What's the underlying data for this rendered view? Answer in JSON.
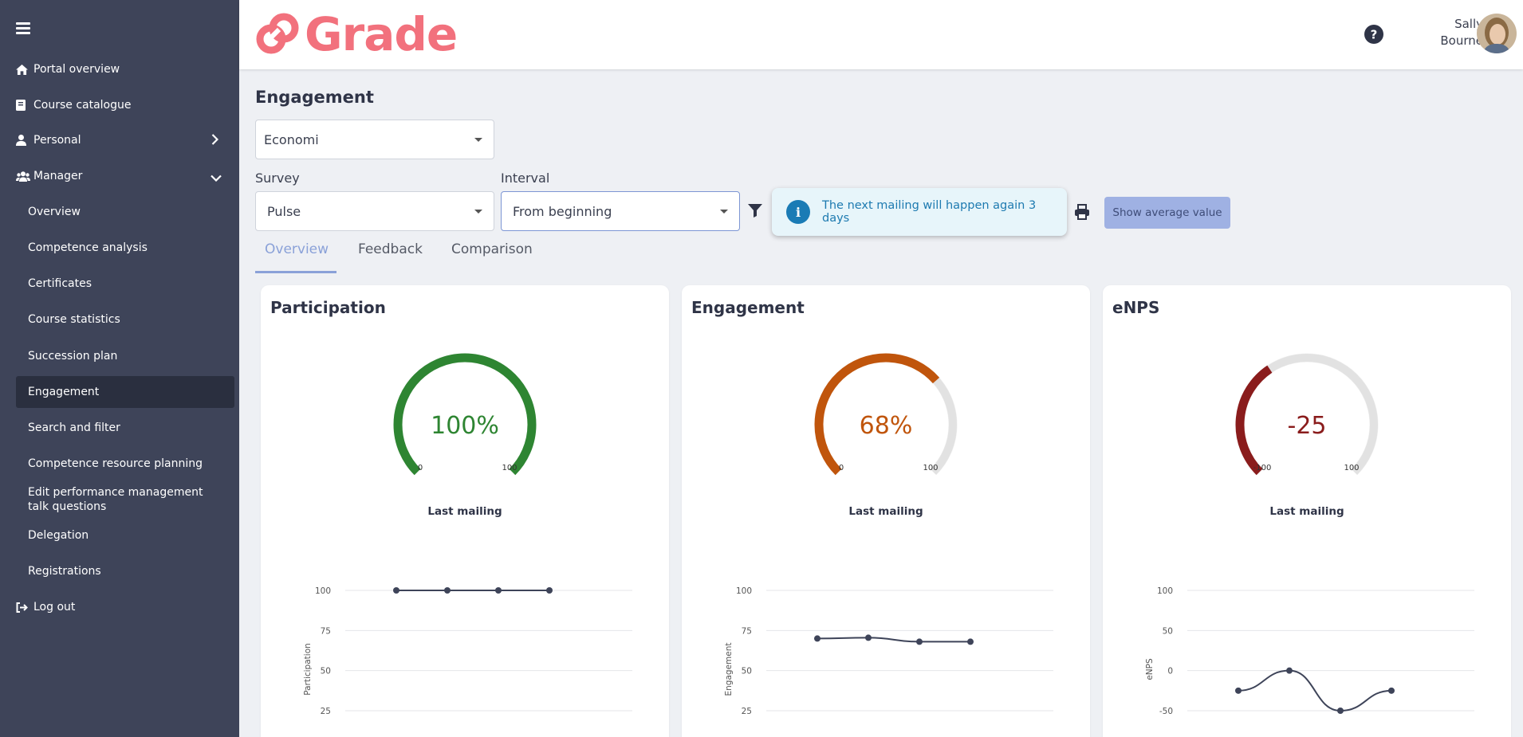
{
  "app": {
    "brand": "Grade",
    "brand_color": "#f2717d"
  },
  "user": {
    "first_name": "Sally",
    "last_name": "Bourne"
  },
  "sidebar": {
    "items": [
      {
        "label": "Portal overview",
        "icon": "home-icon"
      },
      {
        "label": "Course catalogue",
        "icon": "book-icon"
      },
      {
        "label": "Personal",
        "icon": "user-icon",
        "chevron": "chevron-right-icon"
      },
      {
        "label": "Manager",
        "icon": "users-icon",
        "chevron": "chevron-down-icon"
      }
    ],
    "manager_items": [
      {
        "label": "Overview"
      },
      {
        "label": "Competence analysis"
      },
      {
        "label": "Certificates"
      },
      {
        "label": "Course statistics"
      },
      {
        "label": "Succession plan"
      },
      {
        "label": "Engagement",
        "active": true
      },
      {
        "label": "Search and filter"
      },
      {
        "label": "Competence resource planning"
      },
      {
        "label": "Edit performance management talk questions"
      },
      {
        "label": "Delegation"
      },
      {
        "label": "Registrations"
      }
    ],
    "logout": {
      "label": "Log out",
      "icon": "logout-icon"
    }
  },
  "main": {
    "title": "Engagement",
    "department_select": {
      "value": "Economi"
    },
    "survey": {
      "label": "Survey",
      "value": "Pulse"
    },
    "interval": {
      "label": "Interval",
      "value": "From beginning"
    },
    "info_message": "The next mailing will happen again 3 days",
    "average_button": "Show average value",
    "tabs": [
      {
        "label": "Overview",
        "active": true
      },
      {
        "label": "Feedback"
      },
      {
        "label": "Comparison"
      }
    ]
  },
  "cards": [
    {
      "title": "Participation",
      "gauge_label": "100%",
      "gauge_min": "0",
      "gauge_max": "100",
      "gauge_fraction": 1.0,
      "gauge_color": "#2e8532",
      "caption": "Last mailing"
    },
    {
      "title": "Engagement",
      "gauge_label": "68%",
      "gauge_min": "0",
      "gauge_max": "100",
      "gauge_fraction": 0.68,
      "gauge_color": "#c0550c",
      "caption": "Last mailing"
    },
    {
      "title": "eNPS",
      "gauge_label": "-25",
      "gauge_min": "-100",
      "gauge_max": "100",
      "gauge_fraction": 0.375,
      "gauge_color": "#8a1c1c",
      "caption": "Last mailing"
    }
  ],
  "chart_data": [
    {
      "type": "line",
      "ylabel": "Participation",
      "yticks": [
        100,
        75,
        50,
        25
      ],
      "ylim": [
        25,
        100
      ],
      "values": [
        100,
        100,
        100,
        100
      ],
      "grid": true
    },
    {
      "type": "line",
      "ylabel": "Engagement",
      "yticks": [
        100,
        75,
        50,
        25
      ],
      "ylim": [
        25,
        100
      ],
      "values": [
        70,
        70.5,
        68,
        68
      ],
      "grid": true
    },
    {
      "type": "line",
      "ylabel": "eNPS",
      "yticks": [
        100,
        50,
        0,
        -50
      ],
      "ylim": [
        -50,
        100
      ],
      "values": [
        -25,
        0,
        -50,
        -25
      ],
      "grid": true
    }
  ]
}
